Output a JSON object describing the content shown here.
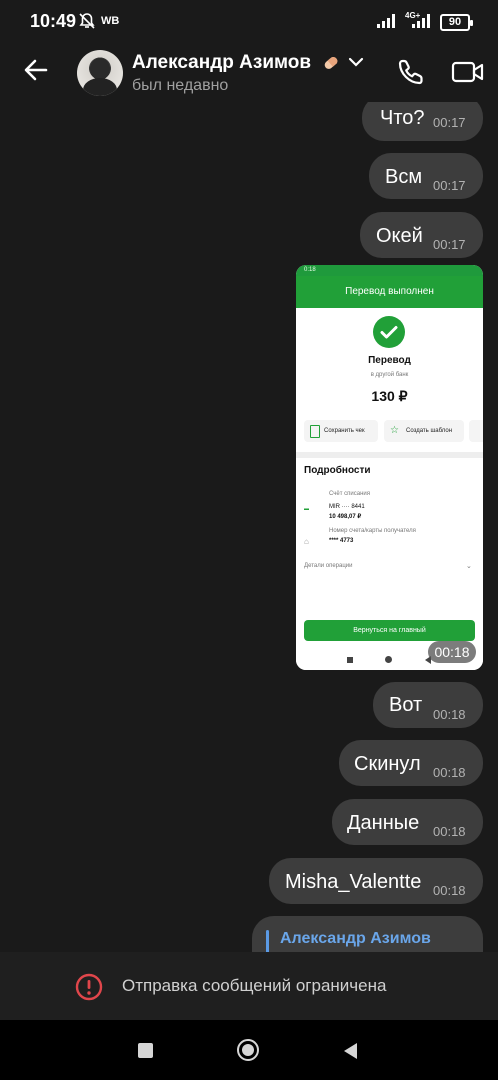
{
  "status_bar": {
    "time": "10:49",
    "carrier": "WB",
    "network": "4G+",
    "battery": "90"
  },
  "header": {
    "contact_name": "Александр Азимов",
    "contact_status": "был недавно"
  },
  "messages": [
    {
      "text": "Что?",
      "time": "00:17"
    },
    {
      "text": "Всм",
      "time": "00:17"
    },
    {
      "text": "Окей",
      "time": "00:17"
    },
    {
      "text": "Вот",
      "time": "00:18"
    },
    {
      "text": "Скинул",
      "time": "00:18"
    },
    {
      "text": "Данные",
      "time": "00:18"
    },
    {
      "text": "Misha_Valentte",
      "time": "00:18"
    }
  ],
  "photo_message": {
    "time": "00:18",
    "screenshot": {
      "status_time": "0:18",
      "bar_title": "Перевод выполнен",
      "title": "Перевод",
      "subtitle": "в другой банк",
      "amount": "130 ₽",
      "btn_save_receipt": "Сохранить чек",
      "btn_template": "Создать шаблон",
      "details_heading": "Подробности",
      "debit_account_label": "Счёт списания",
      "card_mask": "MIR ···· 8441",
      "balance": "10 498,07 ₽",
      "recipient_label": "Номер счета/карты получателя",
      "recipient_value": "**** 4773",
      "operation_details": "Детали операции",
      "back_button": "Вернуться на главный"
    }
  },
  "reply_preview": {
    "name": "Александр Азимов"
  },
  "restriction": {
    "message": "Отправка сообщений ограничена"
  },
  "colors": {
    "background": "#1a1a1a",
    "bubble": "#3d3d3d",
    "accent_blue": "#6aa6ea",
    "warning_red": "#e0464b",
    "sber_green": "#21a038"
  }
}
